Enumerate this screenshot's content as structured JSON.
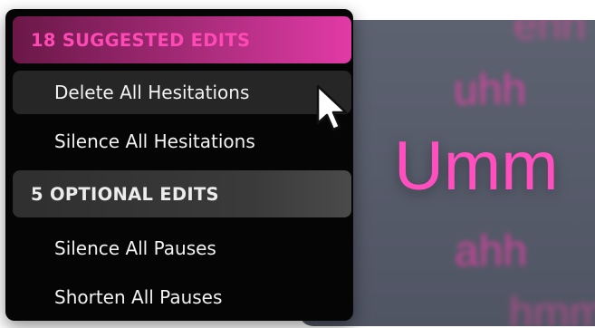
{
  "filler_words": {
    "ehh": "ehh",
    "uhh": "uhh",
    "umm": "Umm",
    "ahh": "ahh",
    "hmm": "hmm"
  },
  "menu": {
    "suggested_header": "18 SUGGESTED EDITS",
    "suggested_items": [
      {
        "label": "Delete All Hesitations",
        "highlighted": true
      },
      {
        "label": "Silence All Hesitations",
        "highlighted": false
      }
    ],
    "optional_header": "5 OPTIONAL EDITS",
    "optional_items": [
      {
        "label": "Silence All Pauses"
      },
      {
        "label": "Shorten All Pauses"
      }
    ]
  },
  "colors": {
    "accent_pink": "#ff49b5",
    "menu_background": "#050505",
    "panel_background": "#5d6271"
  },
  "icons": {
    "cursor": "mouse-pointer-icon"
  }
}
